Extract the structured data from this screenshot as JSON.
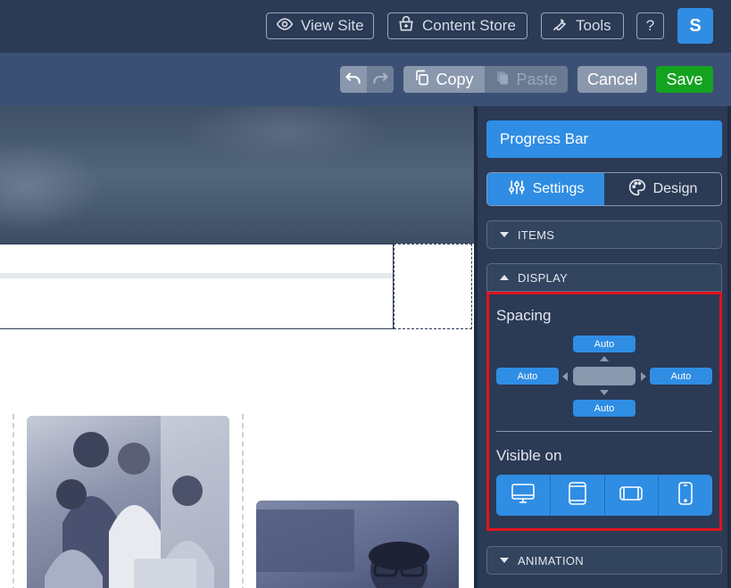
{
  "topbar": {
    "view_site": "View Site",
    "content_store": "Content Store",
    "tools": "Tools",
    "help": "?",
    "avatar": "S"
  },
  "toolbar": {
    "copy": "Copy",
    "paste": "Paste",
    "cancel": "Cancel",
    "save": "Save"
  },
  "panel": {
    "title": "Progress Bar",
    "tabs": {
      "settings": "Settings",
      "design": "Design"
    },
    "sections": {
      "items": "ITEMS",
      "display": "DISPLAY",
      "animation": "ANIMATION"
    },
    "spacing": {
      "label": "Spacing",
      "top": "Auto",
      "left": "Auto",
      "right": "Auto",
      "bottom": "Auto"
    },
    "visible_on": {
      "label": "Visible on",
      "devices": [
        "desktop-icon",
        "tablet-portrait-icon",
        "tablet-landscape-icon",
        "phone-icon"
      ]
    }
  },
  "colors": {
    "accent": "#2f8de4",
    "save": "#14a321",
    "highlight": "#e0131d",
    "chrome": "#2b3a55"
  }
}
